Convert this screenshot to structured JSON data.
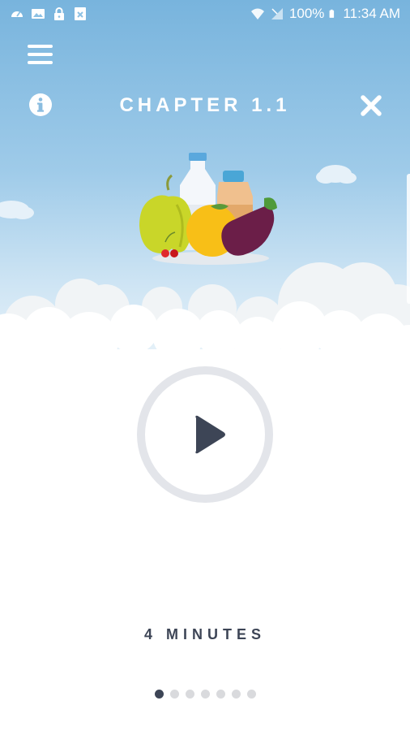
{
  "status_bar": {
    "battery": "100%",
    "time": "11:34 AM",
    "left_icons": [
      "speedometer-icon",
      "image-icon",
      "lock-icon",
      "file-close-icon"
    ],
    "right_icons": [
      "wifi-icon",
      "signal-icon",
      "battery-icon"
    ]
  },
  "header": {
    "title": "CHAPTER 1.1",
    "menu_icon": "hamburger-menu-icon",
    "info_icon": "info-icon",
    "close_icon": "close-icon"
  },
  "illustration": {
    "items": [
      "apple",
      "milk-bottle",
      "jar",
      "orange",
      "eggplant",
      "cherries"
    ]
  },
  "player": {
    "play_icon": "play-icon",
    "duration": "4 MINUTES"
  },
  "pager": {
    "total": 7,
    "active_index": 0
  },
  "colors": {
    "sky_top": "#78b4dd",
    "sky_bottom": "#eef6fb",
    "accent_dark": "#3d4556",
    "ring": "#e3e5ea",
    "dot_inactive": "#d9dadd"
  }
}
